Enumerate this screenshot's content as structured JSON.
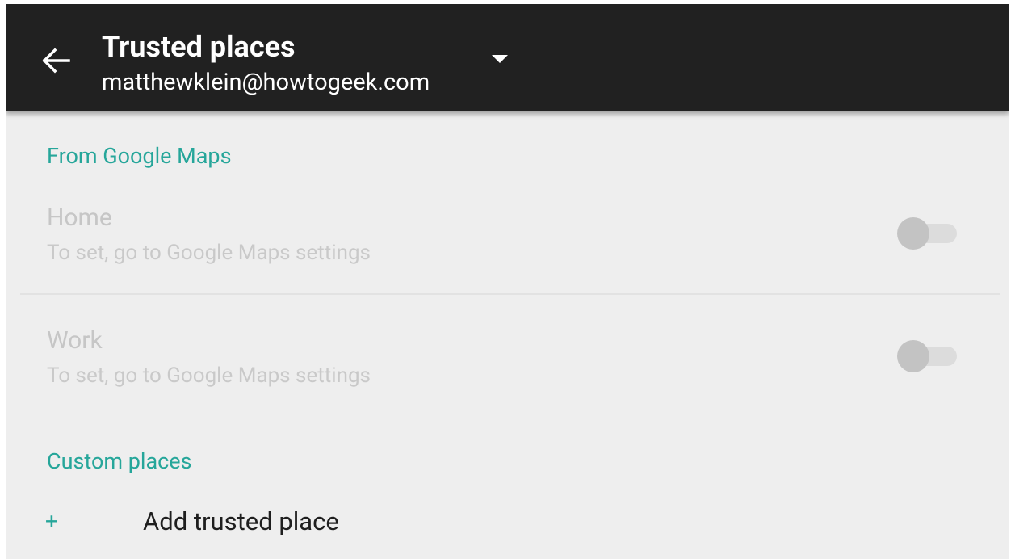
{
  "header": {
    "title": "Trusted places",
    "account": "matthewklein@howtogeek.com",
    "back_icon": "arrow-back-icon",
    "dropdown_icon": "caret-down-icon"
  },
  "sections": {
    "maps": {
      "label": "From Google Maps",
      "home": {
        "title": "Home",
        "subtitle": "To set, go to Google Maps settings",
        "enabled": false
      },
      "work": {
        "title": "Work",
        "subtitle": "To set, go to Google Maps settings",
        "enabled": false
      }
    },
    "custom": {
      "label": "Custom places",
      "add": {
        "icon": "+",
        "label": "Add trusted place"
      }
    }
  },
  "colors": {
    "appbar": "#212121",
    "accent": "#26a69a",
    "background": "#eeeeee",
    "disabled_text": "#c6c6c6"
  }
}
